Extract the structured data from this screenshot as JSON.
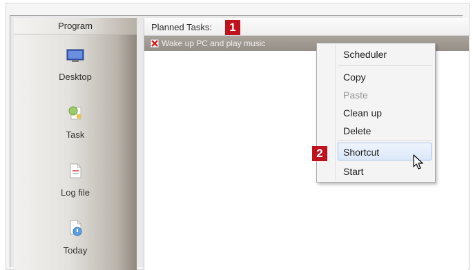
{
  "sidebar": {
    "header": "Program",
    "items": [
      {
        "label": "Desktop",
        "icon": "monitor-icon"
      },
      {
        "label": "Task",
        "icon": "task-icon"
      },
      {
        "label": "Log file",
        "icon": "document-icon"
      },
      {
        "label": "Today",
        "icon": "calendar-document-icon"
      }
    ]
  },
  "main": {
    "header_title": "Planned Tasks:",
    "task": {
      "label": "Wake up PC and play music",
      "icon": "red-x-task-icon"
    }
  },
  "callouts": {
    "one": "1",
    "two": "2"
  },
  "context_menu": {
    "items": [
      {
        "label": "Scheduler",
        "enabled": true
      },
      {
        "label": "Copy",
        "enabled": true
      },
      {
        "label": "Paste",
        "enabled": false
      },
      {
        "label": "Clean up",
        "enabled": true
      },
      {
        "label": "Delete",
        "enabled": true
      },
      {
        "label": "Shortcut",
        "enabled": true,
        "highlighted": true
      },
      {
        "label": "Start",
        "enabled": true
      }
    ]
  },
  "colors": {
    "callout": "#c0121c",
    "selected_row": "#a29c95",
    "menu_highlight": "#dbe8f9"
  }
}
